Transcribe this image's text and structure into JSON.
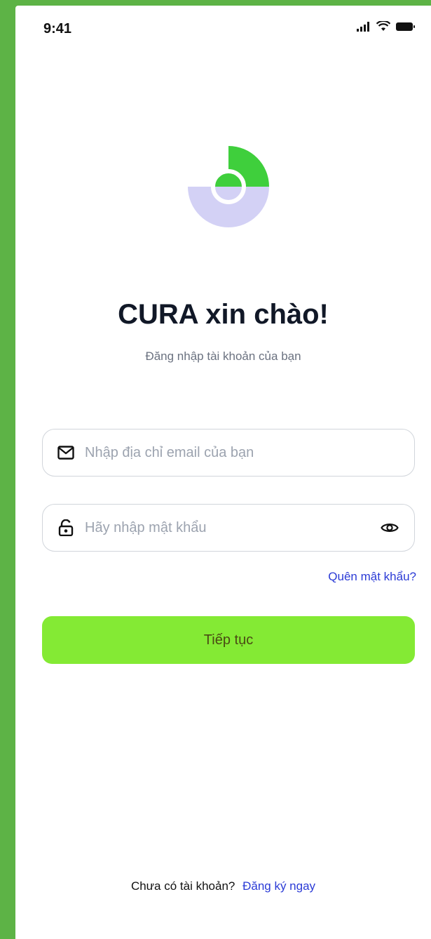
{
  "status_bar": {
    "time": "9:41",
    "icons": [
      "signal-icon",
      "wifi-icon",
      "battery-icon"
    ]
  },
  "brand": {
    "logo_icon": "cura-logo-icon",
    "colors": {
      "green": "#3fcf3c",
      "lavender": "#d3d1f5"
    }
  },
  "header": {
    "title": "CURA xin chào!",
    "subtitle": "Đăng nhập tài khoản của bạn"
  },
  "form": {
    "email": {
      "placeholder": "Nhập địa chỉ email của bạn",
      "value": "",
      "icon": "mail-icon"
    },
    "password": {
      "placeholder": "Hãy nhập mật khẩu",
      "value": "",
      "icon": "lock-icon",
      "toggle_icon": "eye-icon"
    },
    "forgot_label": "Quên mật khẩu?",
    "submit_label": "Tiếp tục"
  },
  "footer": {
    "prompt": "Chưa có tài khoản?",
    "signup_label": "Đăng ký ngay"
  },
  "colors": {
    "accent": "#84ea34",
    "link": "#2b3bd6",
    "frame": "#5db346"
  }
}
